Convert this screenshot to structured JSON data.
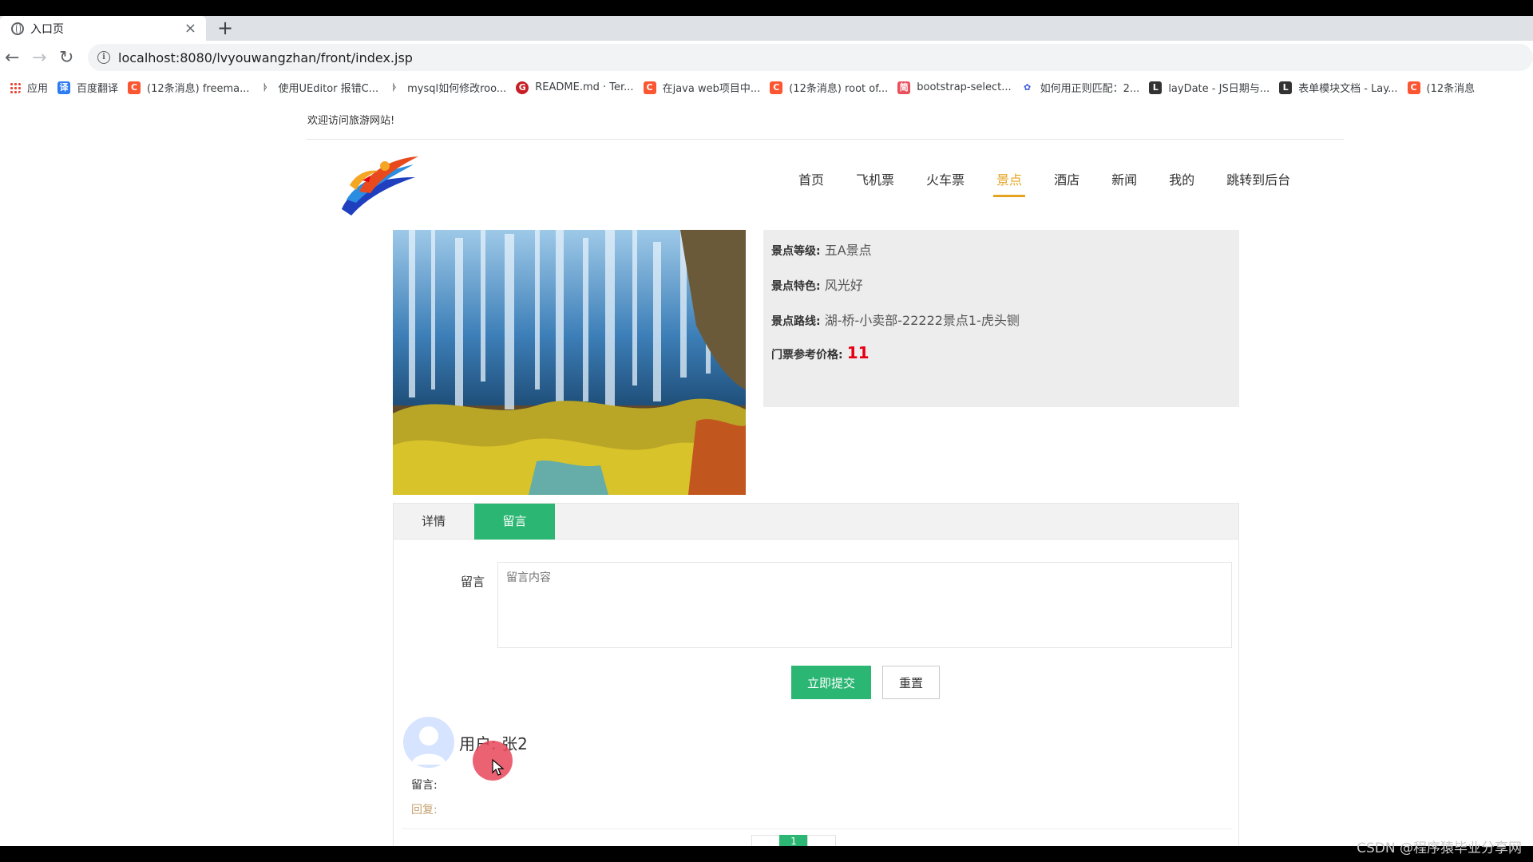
{
  "browser": {
    "tab_title": "入口页",
    "tab_close": "×",
    "new_tab": "+",
    "url": "localhost:8080/lvyouwangzhan/front/index.jsp",
    "bookmarks": [
      {
        "label": "应用",
        "color": "#ea4335"
      },
      {
        "label": "百度翻译",
        "color": "#2b7bf4"
      },
      {
        "label": "(12条消息) freema...",
        "color": "#fc5531"
      },
      {
        "label": "使用UEditor 报错C...",
        "color": "#5f6368"
      },
      {
        "label": "mysql如何修改roo...",
        "color": "#5f6368"
      },
      {
        "label": "README.md · Ter...",
        "color": "#c71d23"
      },
      {
        "label": "在java web项目中...",
        "color": "#fc5531"
      },
      {
        "label": "(12条消息) root of...",
        "color": "#fc5531"
      },
      {
        "label": "bootstrap-select...",
        "color": "#e8505b"
      },
      {
        "label": "如何用正则匹配：2...",
        "color": "#3b5bdb"
      },
      {
        "label": "layDate - JS日期与...",
        "color": "#333333"
      },
      {
        "label": "表单模块文档 - Lay...",
        "color": "#333333"
      },
      {
        "label": "(12条消息",
        "color": "#fc5531"
      }
    ]
  },
  "site": {
    "welcome": "欢迎访问旅游网站!",
    "nav": [
      "首页",
      "飞机票",
      "火车票",
      "景点",
      "酒店",
      "新闻",
      "我的",
      "跳转到后台"
    ],
    "active_nav_index": 3,
    "accent_color": "#e5a31f"
  },
  "attraction": {
    "level_label": "景点等级:",
    "level_value": "五A景点",
    "feature_label": "景点特色:",
    "feature_value": "风光好",
    "route_label": "景点路线:",
    "route_value": "湖-桥-小卖部-22222景点1-虎头铡",
    "price_label": "门票参考价格:",
    "price_value": "11"
  },
  "tabs": {
    "detail": "详情",
    "message": "留言",
    "active": "message",
    "active_color": "#2bb673"
  },
  "form": {
    "label": "留言",
    "placeholder": "留言内容",
    "submit": "立即提交",
    "reset": "重置"
  },
  "comment": {
    "user": "用户: 张2",
    "message_label": "留言:",
    "reply": "回复:"
  },
  "pager": {
    "current": "1"
  },
  "watermark": "CSDN @程序猿毕业分享网"
}
